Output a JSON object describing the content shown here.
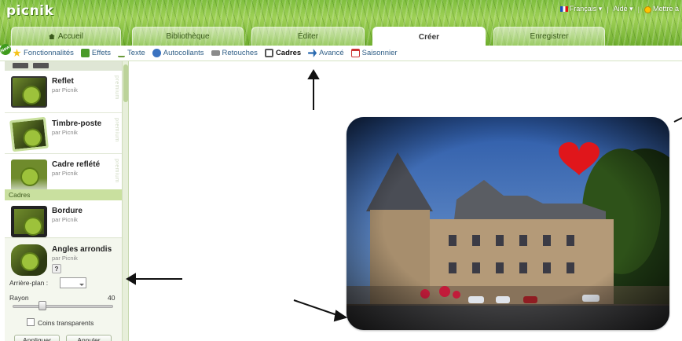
{
  "app": {
    "logo": "picnik"
  },
  "topbar": {
    "language": "Français ▾",
    "help": "Aide ▾",
    "user": "Mettre à"
  },
  "tabs": [
    {
      "label": "Accueil"
    },
    {
      "label": "Bibliothèque"
    },
    {
      "label": "Éditer"
    },
    {
      "label": "Créer"
    },
    {
      "label": "Enregistrer"
    }
  ],
  "toolbar": {
    "new_badge": "New",
    "items": [
      {
        "label": "Fonctionnalités",
        "icon": "star-icon"
      },
      {
        "label": "Effets",
        "icon": "effects-icon"
      },
      {
        "label": "Texte",
        "icon": "text-icon"
      },
      {
        "label": "Autocollants",
        "icon": "sticker-icon"
      },
      {
        "label": "Retouches",
        "icon": "retouch-icon"
      },
      {
        "label": "Cadres",
        "icon": "frame-icon"
      },
      {
        "label": "Avancé",
        "icon": "advanced-icon"
      },
      {
        "label": "Saisonnier",
        "icon": "calendar-icon"
      }
    ]
  },
  "panel": {
    "items": [
      {
        "title": "Reflet",
        "by": "par Picnik",
        "premium": "premium"
      },
      {
        "title": "Timbre-poste",
        "by": "par Picnik",
        "premium": "premium"
      },
      {
        "title": "Cadre reflété",
        "by": "par Picnik",
        "premium": "premium"
      }
    ],
    "section_label": "Cadres",
    "frames": [
      {
        "title": "Bordure",
        "by": "par Picnik"
      },
      {
        "title": "Angles arrondis",
        "by": "par Picnik"
      }
    ],
    "help": "?",
    "background_label": "Arrière-plan :",
    "radius_label": "Rayon",
    "radius_value": "40",
    "radius_fraction": 0.28,
    "transparent_corners": "Coins transparents",
    "apply_button": "Appliquer",
    "cancel_button": "Annuler"
  },
  "colors": {
    "accent": "#7cb83a",
    "link": "#2f5e86",
    "heart": "#e0161b"
  }
}
